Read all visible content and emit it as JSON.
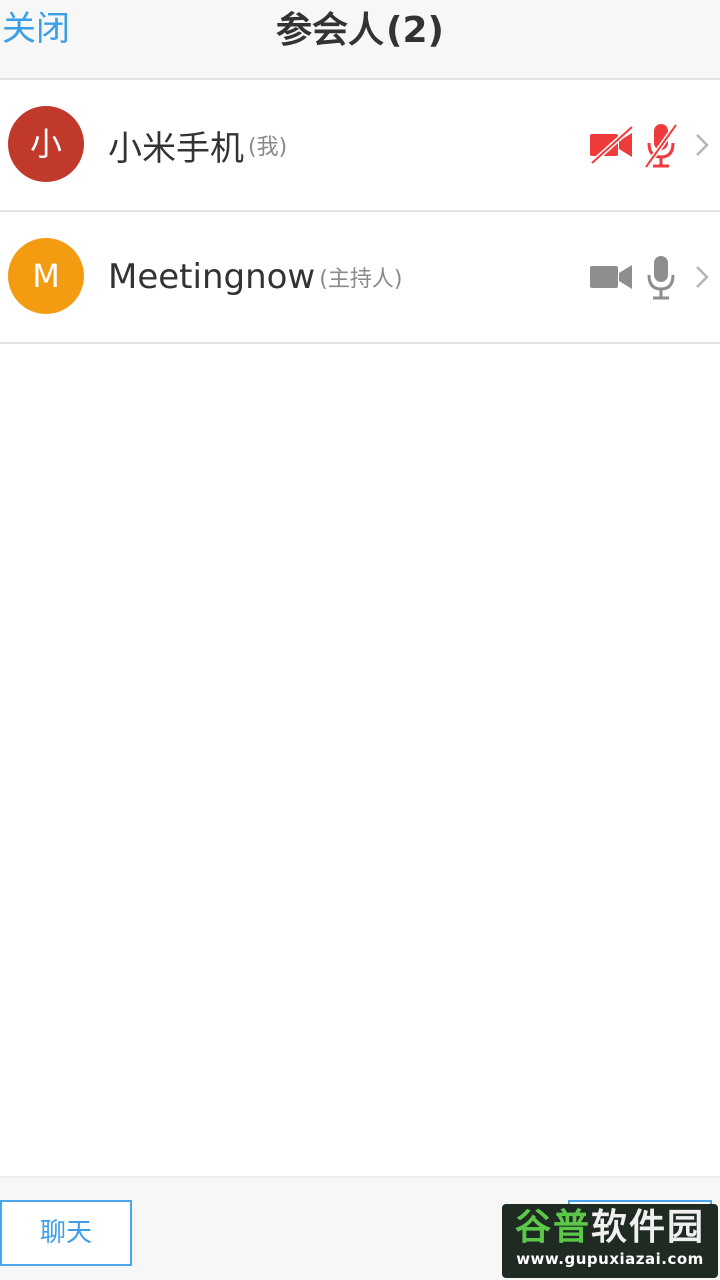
{
  "header": {
    "close_label": "关闭",
    "title": "参会人",
    "count": "(2)"
  },
  "participants": [
    {
      "avatar_letter": "小",
      "avatar_color": "#c0392b",
      "name": "小米手机",
      "role": "(我)",
      "camera": "camera-off-icon",
      "mic": "mic-off-icon",
      "status_color": "#ef3b3b"
    },
    {
      "avatar_letter": "M",
      "avatar_color": "#f39c12",
      "name": "Meetingnow",
      "role": "(主持人)",
      "camera": "camera-icon",
      "mic": "mic-icon",
      "status_color": "#8e8e8e"
    }
  ],
  "bottom": {
    "chat_label": "聊天"
  },
  "watermark": {
    "text_a": "谷普",
    "text_b": "软件园",
    "url": "www.gupuxiazai.com"
  },
  "colors": {
    "accent": "#3a9ee8",
    "muted_red": "#ef3b3b",
    "icon_gray": "#8e8e8e"
  }
}
